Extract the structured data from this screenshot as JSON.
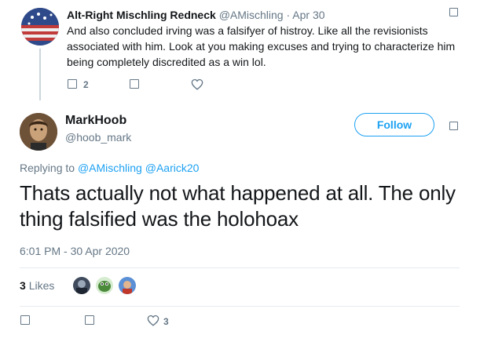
{
  "parent_tweet": {
    "display_name": "Alt-Right Mischling Redneck",
    "handle": "@AMischling",
    "separator": "·",
    "date": "Apr 30",
    "text": "And also concluded irving was a falsifyer of histroy. Like all the revisionists associated with him. Look at you making excuses and trying to characterize him being completely discredited as a win lol.",
    "reply_count": "2"
  },
  "main_tweet": {
    "display_name": "MarkHoob",
    "handle": "@hoob_mark",
    "follow_label": "Follow",
    "replying_prefix": "Replying to",
    "mentions": [
      "@AMischling",
      "@Aarick20"
    ],
    "text": "Thats actually not what happened at all. The only thing falsified was the holohoax",
    "timestamp": "6:01 PM - 30 Apr 2020",
    "likes_count": "3",
    "likes_label": "Likes",
    "like_action_count": "3"
  },
  "icons": {
    "reply": "reply-icon",
    "retweet": "retweet-icon",
    "like": "heart-icon",
    "menu": "chevron-down-icon"
  },
  "colors": {
    "accent": "#1da1f2",
    "text": "#14171a",
    "muted": "#657786",
    "divider": "#e6ecf0"
  }
}
